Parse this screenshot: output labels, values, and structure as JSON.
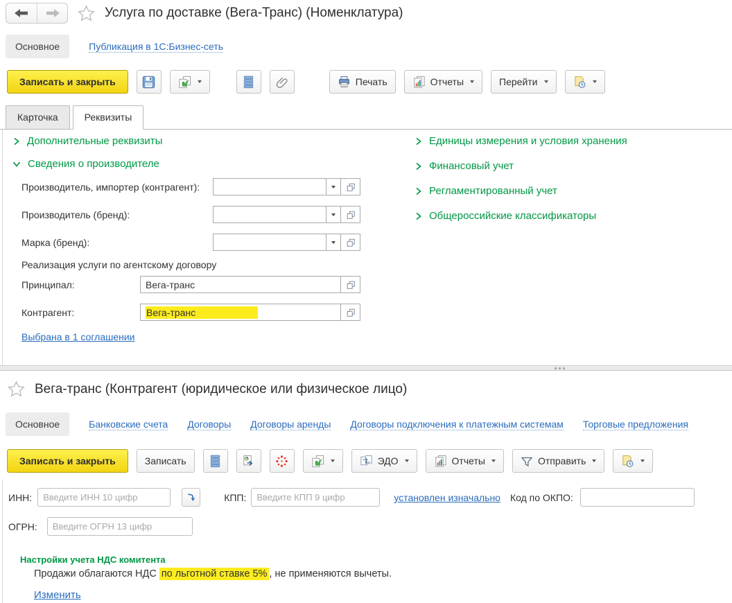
{
  "colors": {
    "accent_yellow": "#f3d412",
    "link_blue": "#2a6cbd",
    "section_green": "#009845",
    "highlight_yellow": "#fcec1e"
  },
  "top_panel": {
    "title": "Услуга по доставке (Вега-Транс) (Номенклатура)",
    "nav": {
      "active_tab": "Основное",
      "publication_link": "Публикация в 1С:Бизнес-сеть"
    },
    "toolbar": {
      "save_and_close": "Записать и закрыть",
      "print": "Печать",
      "reports": "Отчеты",
      "goto": "Перейти"
    },
    "page_tabs": {
      "card": "Карточка",
      "details": "Реквизиты"
    },
    "left": {
      "section_additional": "Дополнительные реквизиты",
      "section_manufacturer": "Сведения о производителе",
      "field_importer_label": "Производитель, импортер (контрагент):",
      "field_brand_label": "Производитель (бренд):",
      "field_mark_label": "Марка (бренд):",
      "agency_caption": "Реализация услуги по агентскому договору",
      "principal_label": "Принципал:",
      "principal_value": "Вега-транс",
      "counterparty_label": "Контрагент:",
      "counterparty_value": "Вега-транс",
      "agreements_link": "Выбрана в 1 соглашении"
    },
    "right_sections": [
      "Единицы измерения и условия хранения",
      "Финансовый учет",
      "Регламентированный учет",
      "Общероссийские классификаторы"
    ]
  },
  "bottom_panel": {
    "title": "Вега-транс (Контрагент (юридическое или физическое лицо)",
    "nav": {
      "active_tab": "Основное",
      "links": [
        "Банковские счета",
        "Договоры",
        "Договоры аренды",
        "Договоры подключения к платежным системам",
        "Торговые предложения"
      ]
    },
    "toolbar": {
      "save_and_close": "Записать и закрыть",
      "save": "Записать",
      "edo": "ЭДО",
      "reports": "Отчеты",
      "send": "Отправить"
    },
    "fields": {
      "inn_label": "ИНН:",
      "inn_placeholder": "Введите ИНН 10 цифр",
      "kpp_label": "КПП:",
      "kpp_placeholder": "Введите КПП 9 цифр",
      "kpp_link": "установлен изначально",
      "okpo_label": "Код по ОКПО:",
      "ogrn_label": "ОГРН:",
      "ogrn_placeholder": "Введите ОГРН 13 цифр"
    },
    "vat": {
      "heading": "Настройки учета НДС комитента",
      "text_before": "Продажи облагаются НДС ",
      "highlighted": "по льготной ставке 5%",
      "text_after": ", не применяются вычеты.",
      "change_link": "Изменить"
    }
  }
}
